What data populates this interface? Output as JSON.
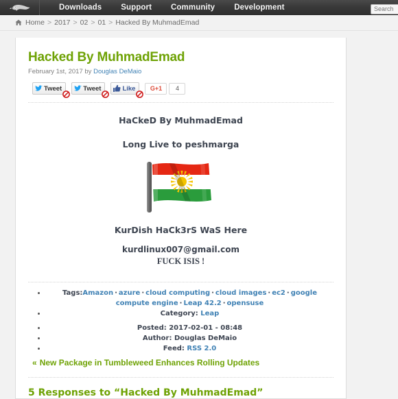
{
  "topnav": {
    "logo_name": "opensuse-chameleon-logo",
    "items": [
      {
        "label": "Downloads",
        "name": "nav-item-downloads"
      },
      {
        "label": "Support",
        "name": "nav-item-support"
      },
      {
        "label": "Community",
        "name": "nav-item-community"
      },
      {
        "label": "Development",
        "name": "nav-item-development"
      }
    ],
    "search_placeholder": "Search",
    "search_value": ""
  },
  "breadcrumb": {
    "home_icon": "home-icon",
    "items": [
      "Home",
      "2017",
      "02",
      "01",
      "Hacked By MuhmadEmad"
    ],
    "separator": ">"
  },
  "post": {
    "title": "Hacked By MuhmadEmad",
    "date": "February 1st, 2017",
    "by_label": "by",
    "author": "Douglas DeMaio"
  },
  "share": {
    "tweet_label_1": "Tweet",
    "tweet_label_2": "Tweet",
    "like_label": "Like",
    "gplus_label": "G+1",
    "gplus_count": "4",
    "blocked_icon": "blocked-icon"
  },
  "deface": {
    "heading": "HaCkeD By MuhmadEmad",
    "subheading": "Long Live to peshmarga",
    "flag_icon": "kurdistan-flag-image",
    "signature": "KurDish HaCk3rS WaS Here",
    "email": "kurdlinux007@gmail.com",
    "slogan": "FUCK ISIS !"
  },
  "tags": {
    "label": "Tags:",
    "items": [
      "Amazon",
      "azure",
      "cloud computing",
      "cloud images",
      "ec2",
      "google compute engine",
      "Leap 42.2",
      "opensuse"
    ],
    "separator": "·",
    "category_label": "Category:",
    "category_value": "Leap"
  },
  "meta": {
    "posted_label": "Posted:",
    "posted_value": "2017-02-01 - 08:48",
    "author_label": "Author:",
    "author_value": "Douglas DeMaio",
    "feed_label": "Feed:",
    "feed_value": "RSS 2.0"
  },
  "navigation": {
    "prev_chevron": "«",
    "prev_post": "New Package in Tumbleweed Enhances Rolling Updates"
  },
  "comments": {
    "heading": "5 Responses to “Hacked By MuhmadEmad”"
  },
  "colors": {
    "green": "#6ea204",
    "link_blue": "#3f81b4",
    "navbar_dark": "#393939",
    "page_bg": "#f2f2f2",
    "flag_red": "#e52713",
    "flag_white": "#ffffff",
    "flag_green": "#2a9c3c",
    "flag_sun": "#f5c400"
  }
}
